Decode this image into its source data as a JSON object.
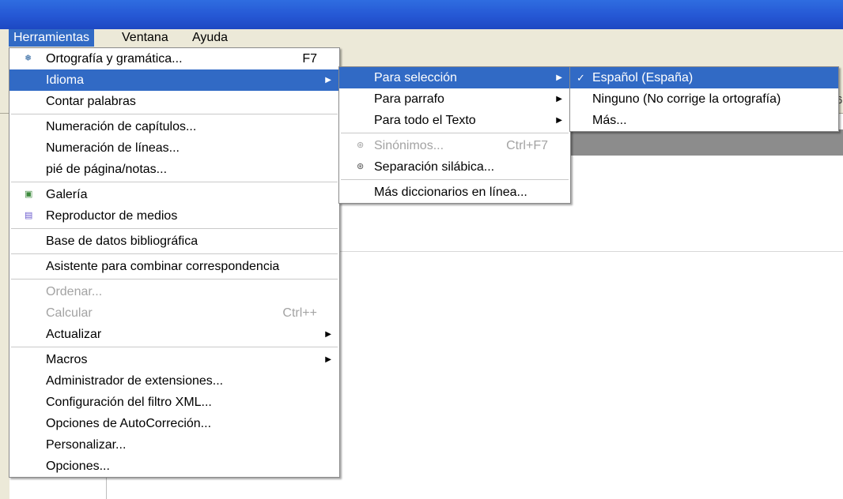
{
  "menubar": {
    "items": [
      "Herramientas",
      "Ventana",
      "Ayuda"
    ]
  },
  "ruler": {
    "fragment": "6"
  },
  "tools_menu": {
    "items": [
      {
        "label": "Ortografía y gramática...",
        "shortcut": "F7",
        "icon": "spellcheck-icon"
      },
      {
        "label": "Idioma",
        "submenu": true
      },
      {
        "label": "Contar palabras"
      },
      {
        "label": "Numeración de capítulos..."
      },
      {
        "label": "Numeración de líneas..."
      },
      {
        "label": "pié de página/notas..."
      },
      {
        "label": "Galería",
        "icon": "gallery-icon"
      },
      {
        "label": "Reproductor de medios",
        "icon": "media-player-icon"
      },
      {
        "label": "Base de datos bibliográfica"
      },
      {
        "label": "Asistente para combinar correspondencia"
      },
      {
        "label": "Ordenar...",
        "disabled": true
      },
      {
        "label": "Calcular",
        "shortcut": "Ctrl++",
        "disabled": true
      },
      {
        "label": "Actualizar",
        "submenu": true
      },
      {
        "label": "Macros",
        "submenu": true
      },
      {
        "label": "Administrador de extensiones..."
      },
      {
        "label": "Configuración del filtro XML..."
      },
      {
        "label": "Opciones de AutoCorreción..."
      },
      {
        "label": "Personalizar..."
      },
      {
        "label": "Opciones..."
      }
    ]
  },
  "language_menu": {
    "items": [
      {
        "label": "Para selección",
        "submenu": true
      },
      {
        "label": "Para parrafo",
        "submenu": true
      },
      {
        "label": "Para todo el Texto",
        "submenu": true
      },
      {
        "label": "Sinónimos...",
        "shortcut": "Ctrl+F7",
        "disabled": true,
        "icon": "thesaurus-icon"
      },
      {
        "label": "Separación silábica...",
        "icon": "hyphenation-icon"
      },
      {
        "label": "Más diccionarios en línea..."
      }
    ]
  },
  "selection_language_menu": {
    "items": [
      {
        "label": "Español (España)",
        "checked": true
      },
      {
        "label": "Ninguno (No corrige la ortografía)"
      },
      {
        "label": "Más..."
      }
    ]
  },
  "colors": {
    "highlight": "#316ac5",
    "titlebar": "#2557d4",
    "menubar": "#ece9d8",
    "disabled_text": "#a3a3a3"
  }
}
